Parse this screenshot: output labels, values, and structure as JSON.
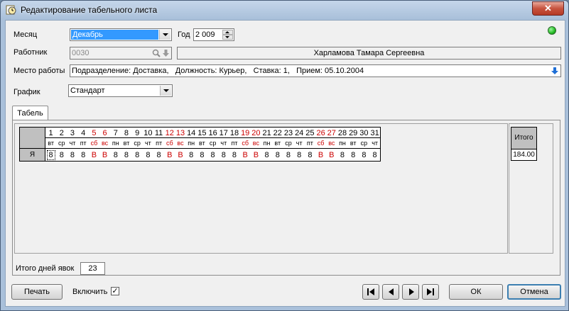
{
  "window": {
    "title": "Редактирование табельного листа",
    "close_label": "✕"
  },
  "form": {
    "month_label": "Месяц",
    "month_value": "Декабрь",
    "year_label": "Год",
    "year_value": "2 009",
    "employee_label": "Работник",
    "employee_code": "0030",
    "employee_name": "Харламова Тамара Сергеевна",
    "workplace_label": "Место работы",
    "workplace_value": "Подразделение: Доставка,   Должность: Курьер,   Ставка: 1,   Прием: 05.10.2004",
    "schedule_label": "График",
    "schedule_value": "Стандарт",
    "status_color": "#22bb22"
  },
  "tabs": [
    {
      "label": "Табель"
    }
  ],
  "timesheet": {
    "row_label": "Я",
    "days": [
      {
        "n": "1",
        "d": "вт",
        "v": "8",
        "we": false
      },
      {
        "n": "2",
        "d": "ср",
        "v": "8",
        "we": false
      },
      {
        "n": "3",
        "d": "чт",
        "v": "8",
        "we": false
      },
      {
        "n": "4",
        "d": "пт",
        "v": "8",
        "we": false
      },
      {
        "n": "5",
        "d": "сб",
        "v": "В",
        "we": true
      },
      {
        "n": "6",
        "d": "вс",
        "v": "В",
        "we": true
      },
      {
        "n": "7",
        "d": "пн",
        "v": "8",
        "we": false
      },
      {
        "n": "8",
        "d": "вт",
        "v": "8",
        "we": false
      },
      {
        "n": "9",
        "d": "ср",
        "v": "8",
        "we": false
      },
      {
        "n": "10",
        "d": "чт",
        "v": "8",
        "we": false
      },
      {
        "n": "11",
        "d": "пт",
        "v": "8",
        "we": false
      },
      {
        "n": "12",
        "d": "сб",
        "v": "В",
        "we": true
      },
      {
        "n": "13",
        "d": "вс",
        "v": "В",
        "we": true
      },
      {
        "n": "14",
        "d": "пн",
        "v": "8",
        "we": false
      },
      {
        "n": "15",
        "d": "вт",
        "v": "8",
        "we": false
      },
      {
        "n": "16",
        "d": "ср",
        "v": "8",
        "we": false
      },
      {
        "n": "17",
        "d": "чт",
        "v": "8",
        "we": false
      },
      {
        "n": "18",
        "d": "пт",
        "v": "8",
        "we": false
      },
      {
        "n": "19",
        "d": "сб",
        "v": "В",
        "we": true
      },
      {
        "n": "20",
        "d": "вс",
        "v": "В",
        "we": true
      },
      {
        "n": "21",
        "d": "пн",
        "v": "8",
        "we": false
      },
      {
        "n": "22",
        "d": "вт",
        "v": "8",
        "we": false
      },
      {
        "n": "23",
        "d": "ср",
        "v": "8",
        "we": false
      },
      {
        "n": "24",
        "d": "чт",
        "v": "8",
        "we": false
      },
      {
        "n": "25",
        "d": "пт",
        "v": "8",
        "we": false
      },
      {
        "n": "26",
        "d": "сб",
        "v": "В",
        "we": true
      },
      {
        "n": "27",
        "d": "вс",
        "v": "В",
        "we": true
      },
      {
        "n": "28",
        "d": "пн",
        "v": "8",
        "we": false
      },
      {
        "n": "29",
        "d": "вт",
        "v": "8",
        "we": false
      },
      {
        "n": "30",
        "d": "ср",
        "v": "8",
        "we": false
      },
      {
        "n": "31",
        "d": "чт",
        "v": "8",
        "we": false
      }
    ],
    "total_header": "Итого",
    "total_value": "184.00",
    "weekend_color": "#cc0000"
  },
  "summary": {
    "days_label": "Итого дней явок",
    "days_value": "23"
  },
  "footer": {
    "print_label": "Печать",
    "include_label": "Включить",
    "include_checked": "✓",
    "ok_label": "ОК",
    "cancel_label": "Отмена"
  }
}
